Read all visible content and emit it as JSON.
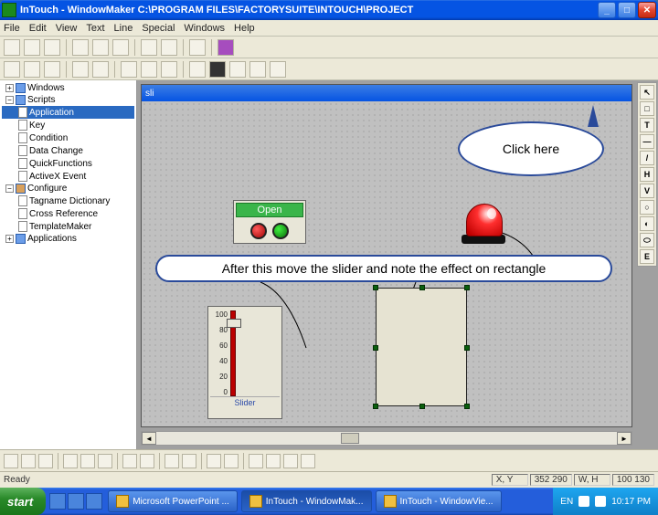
{
  "window": {
    "title": "InTouch - WindowMaker   C:\\PROGRAM FILES\\FACTORYSUITE\\INTOUCH\\PROJECT",
    "min_label": "_",
    "max_label": "□",
    "close_label": "✕"
  },
  "menubar": [
    "File",
    "Edit",
    "View",
    "Text",
    "Line",
    "Special",
    "Windows",
    "Help"
  ],
  "explorer": {
    "items": [
      {
        "exp": "+",
        "label": "Windows",
        "cls": ""
      },
      {
        "exp": "-",
        "label": "Scripts",
        "cls": ""
      },
      {
        "exp": "",
        "label": "Application",
        "cls": "tree-ind1 sel"
      },
      {
        "exp": "",
        "label": "Key",
        "cls": "tree-ind1"
      },
      {
        "exp": "",
        "label": "Condition",
        "cls": "tree-ind1"
      },
      {
        "exp": "",
        "label": "Data Change",
        "cls": "tree-ind1"
      },
      {
        "exp": "",
        "label": "QuickFunctions",
        "cls": "tree-ind1"
      },
      {
        "exp": "",
        "label": "ActiveX Event",
        "cls": "tree-ind1"
      },
      {
        "exp": "-",
        "label": "Configure",
        "cls": ""
      },
      {
        "exp": "",
        "label": "Tagname Dictionary",
        "cls": "tree-ind1"
      },
      {
        "exp": "",
        "label": "Cross Reference",
        "cls": "tree-ind1"
      },
      {
        "exp": "",
        "label": "TemplateMaker",
        "cls": "tree-ind1"
      },
      {
        "exp": "+",
        "label": "Applications",
        "cls": ""
      }
    ]
  },
  "doc": {
    "title": "sli"
  },
  "openpanel": {
    "label": "Open"
  },
  "callout": {
    "text": "Click here"
  },
  "instruction": {
    "text": "After this move the slider and note the effect on rectangle"
  },
  "slider": {
    "ticks": [
      "100",
      "80",
      "60",
      "40",
      "20",
      "0"
    ],
    "caption": "Slider"
  },
  "vtools": [
    "↖",
    "□",
    "T",
    "—",
    "/",
    "H",
    "V",
    "○",
    "◐",
    "⬭",
    "E"
  ],
  "statusbar": {
    "ready": "Ready",
    "xy_label": "X, Y",
    "xy_val": "352        290",
    "wh_label": "W, H",
    "wh_val": "100        130"
  },
  "taskbar": {
    "start": "start",
    "items": [
      "Microsoft PowerPoint ...",
      "InTouch - WindowMak...",
      "InTouch - WindowVie..."
    ],
    "time": "10:17 PM",
    "lang": "EN"
  }
}
